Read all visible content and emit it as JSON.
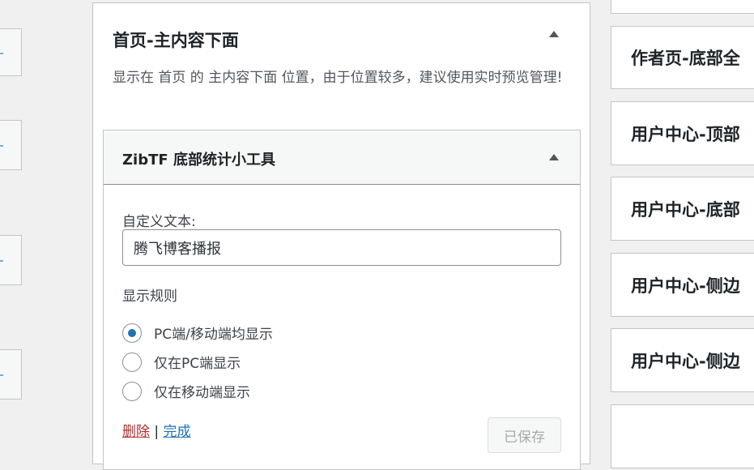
{
  "left_column": {
    "count": 4
  },
  "main_area": {
    "title": "首页-主内容下面",
    "description": "显示在 首页 的 主内容下面 位置，由于位置较多，建议使用实时预览管理!",
    "widget": {
      "title": "ZibTF 底部统计小工具",
      "custom_text_label": "自定义文本:",
      "custom_text_value": "腾飞博客播报",
      "display_rule_label": "显示规则",
      "options": [
        {
          "label": "PC端/移动端均显示",
          "checked": true
        },
        {
          "label": "仅在PC端显示",
          "checked": false
        },
        {
          "label": "仅在移动端显示",
          "checked": false
        }
      ],
      "delete_label": "删除",
      "separator": "|",
      "done_label": "完成",
      "saved_label": "已保存"
    }
  },
  "right_column": {
    "areas": [
      "作者页-底部全",
      "用户中心-顶部",
      "用户中心-底部",
      "用户中心-侧边",
      "用户中心-侧边"
    ]
  }
}
